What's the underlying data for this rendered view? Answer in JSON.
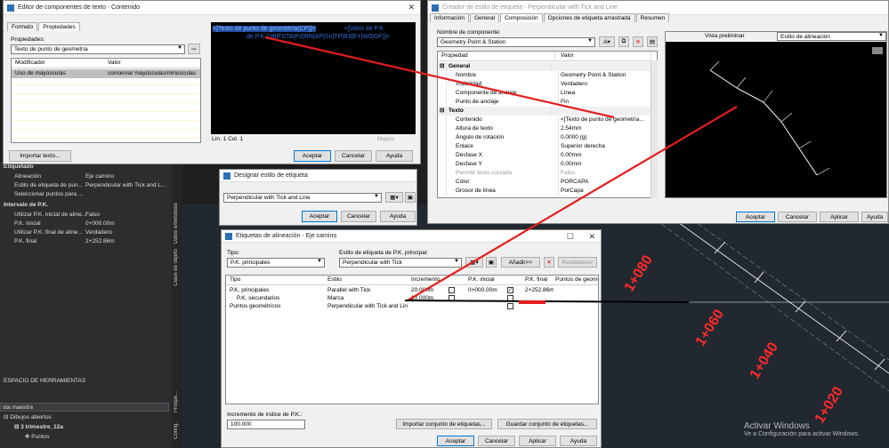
{
  "text_editor": {
    "title": "Editor de componentes de texto - Contenido",
    "tabs": [
      "Formato",
      "Propiedades"
    ],
    "props_label": "Propiedades:",
    "props_combo": "Texto de punto de geometría",
    "col_modifier": "Modificador",
    "col_value": "Valor",
    "row_modifier": "Uso de mayúsculas",
    "row_value": "conservar mayúsculas/minúsculas",
    "code_line1a": "<[Texto de punto de geometría(CP)]>",
    "code_line1b": "<[Valor de P.K.",
    "code_line2": "de P.K.(Uft|FSTA|P2|RN|AP|Sn|TP|B3|EY|W0|OF)]>",
    "status_pos": "Lín. 1 Col. 1",
    "status_mode": "Mayús",
    "import_btn": "Importar texto...",
    "ok_btn": "Aceptar",
    "cancel_btn": "Cancelar",
    "help_btn": "Ayuda"
  },
  "style_creator": {
    "title": "Creador de estilo de etiqueta - Perpendicular with Tick and Line",
    "tabs": [
      "Información",
      "General",
      "Composición",
      "Opciones de etiqueta arrastrada",
      "Resumen"
    ],
    "component_label": "Nombre de componente:",
    "component_value": "Geometry Point & Station",
    "col_property": "Propiedad",
    "col_value": "Valor",
    "rows": [
      {
        "p": "General",
        "v": "",
        "group": true
      },
      {
        "p": "Nombre",
        "v": "Geometry Point & Station"
      },
      {
        "p": "Visibilidad",
        "v": "Verdadero"
      },
      {
        "p": "Componente de anclaje",
        "v": "Línea"
      },
      {
        "p": "Punto de anclaje",
        "v": "Fin"
      },
      {
        "p": "Texto",
        "v": "",
        "group": true
      },
      {
        "p": "Contenido",
        "v": "<[Texto de punto de geometría..."
      },
      {
        "p": "Altura de texto",
        "v": "2.54mm"
      },
      {
        "p": "Ángulo de rotación",
        "v": "0.0000 (g)"
      },
      {
        "p": "Enlace",
        "v": "Superior derecha"
      },
      {
        "p": "Desfase X",
        "v": "0.00mm"
      },
      {
        "p": "Desfase Y",
        "v": "0.00mm"
      },
      {
        "p": "Permitir texto curvado",
        "v": "Falso"
      },
      {
        "p": "Color",
        "v": "PORCAPA"
      },
      {
        "p": "Grosor de línea",
        "v": "PorCapa"
      }
    ],
    "preview_label": "Vista preliminar",
    "preview_combo": "Estilo de alineación",
    "ok_btn": "Aceptar",
    "cancel_btn": "Cancelar",
    "apply_btn": "Aplicar",
    "help_btn": "Ayuda"
  },
  "designate": {
    "title": "Designar estilo de etiqueta",
    "combo": "Perpendicular with Tick and Line",
    "ok_btn": "Aceptar",
    "cancel_btn": "Cancelar",
    "help_btn": "Ayuda"
  },
  "alignment_labels": {
    "title": "Etiquetas de alineación - Eje camino",
    "type_label": "Tipo:",
    "type_value": "P.K. principales",
    "style_label": "Estilo de etiqueta de P.K. principal:",
    "style_value": "Perpendicular with Tick",
    "add_btn": "Añadir>>",
    "reset_btn": "Restablecer",
    "cols": [
      "Tipo",
      "Estilo",
      "Incremento",
      "",
      "P.K. inicial",
      "",
      "P.K. final",
      "Puntos de geometría"
    ],
    "rows": [
      {
        "tipo": "P.K. principales",
        "estilo": "Parallel with Tick",
        "inc": "20.000m",
        "ini": "0+000.00m",
        "fin": "2+252.86m"
      },
      {
        "tipo": "P.K. secundarios",
        "estilo": "Marca",
        "inc": "10.000m",
        "ini": "",
        "fin": ""
      },
      {
        "tipo": "Puntos geométricos",
        "estilo": "Perpendicular with Tick and Line",
        "inc": "",
        "ini": "",
        "fin": ""
      }
    ],
    "increment_label": "Incremento de índice de P.K.:",
    "increment_value": "100.000",
    "import_btn": "Importar conjunto de etiquetas...",
    "save_btn": "Guardar conjunto de etiquetas...",
    "ok_btn": "Aceptar",
    "cancel_btn": "Cancelar",
    "apply_btn": "Aplicar",
    "help_btn": "Ayuda"
  },
  "left_panel": {
    "section_label": "Etiquetado",
    "rows": [
      {
        "k": "Alineación",
        "v": "Eje camino"
      },
      {
        "k": "Estilo de etiqueta de pun...",
        "v": "Perpendicular with Tick and L..."
      },
      {
        "k": "Seleccionar puntos para ...",
        "v": ""
      }
    ],
    "section2": "Intervalo de P.K.",
    "rows2": [
      {
        "k": "Utilizar P.K. inicial de aline...",
        "v": "Falso"
      },
      {
        "k": "P.K. inicial",
        "v": "0+000.00m"
      },
      {
        "k": "Utilizar P.K. final de aline...",
        "v": "Verdadero"
      },
      {
        "k": "P.K. final",
        "v": "2+252.86m"
      }
    ],
    "toolspace": "ESPACIO DE HERRAMIENTAS",
    "view_combo": "sta maestra",
    "tree": [
      "Dibujos abiertos",
      "3 trimestre_12a",
      "Puntos"
    ],
    "vtabs": [
      "Datos extendidos",
      "Clase de objeto",
      "Prospe...",
      "Config."
    ]
  },
  "cad": {
    "stations": [
      "1+080",
      "1+060",
      "1+040",
      "1+020"
    ],
    "watermark1": "Activar Windows",
    "watermark2": "Ve a Configuración para activar Windows."
  },
  "colors": {
    "accent": "#0078d7",
    "red": "#ff2a2a",
    "code_bg": "#000000",
    "code_fg": "#3a6fd8"
  }
}
